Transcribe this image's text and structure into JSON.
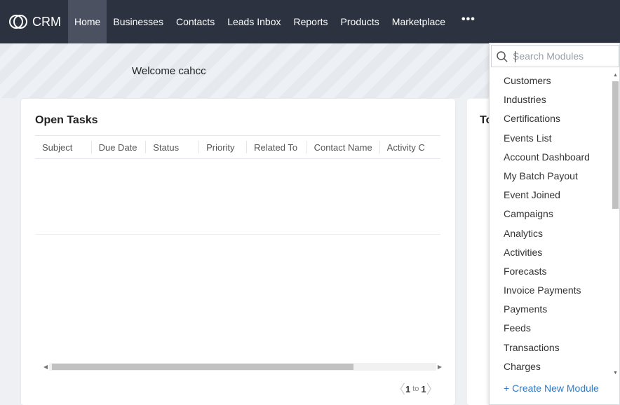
{
  "app": {
    "logo_text": "CRM",
    "logo_icon": "crm-logo-icon"
  },
  "nav": {
    "items": [
      {
        "label": "Home",
        "active": true
      },
      {
        "label": "Businesses"
      },
      {
        "label": "Contacts"
      },
      {
        "label": "Leads Inbox"
      },
      {
        "label": "Reports"
      },
      {
        "label": "Products"
      },
      {
        "label": "Marketplace"
      }
    ],
    "more_label": "•••"
  },
  "banner": {
    "welcome": "Welcome cahcc"
  },
  "open_tasks": {
    "title": "Open Tasks",
    "columns": [
      "Subject",
      "Due Date",
      "Status",
      "Priority",
      "Related To",
      "Contact Name",
      "Activity C"
    ],
    "pager": {
      "from": "1",
      "to_label": "to",
      "to": "1"
    }
  },
  "second_card": {
    "title": "To"
  },
  "modules_dropdown": {
    "search_placeholder": "Search Modules",
    "items": [
      "Customers",
      "Industries",
      "Certifications",
      "Events List",
      "Account Dashboard",
      "My Batch Payout",
      "Event Joined",
      "Campaigns",
      "Analytics",
      "Activities",
      "Forecasts",
      "Invoice Payments",
      "Payments",
      "Feeds",
      "Transactions",
      "Charges"
    ],
    "create_label": "+ Create New Module"
  },
  "colors": {
    "topbar": "#2c323f",
    "active_nav": "#4b5160",
    "link": "#2f7bc6"
  }
}
